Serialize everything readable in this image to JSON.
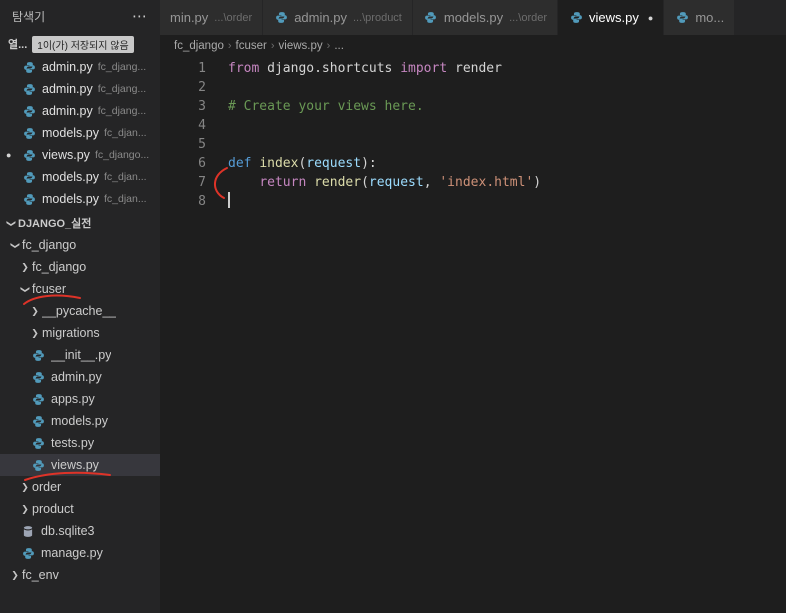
{
  "colors": {
    "editor_bg": "#1e1e1e",
    "sidebar_bg": "#252526",
    "tab_inactive_bg": "#2d2d2d",
    "selection_bg": "#37373d",
    "python_icon": "#519aba",
    "database_icon": "#9da5b4"
  },
  "icons": {
    "more": "⋯",
    "dirty_dot": "●",
    "chevron": "❯",
    "breadcrumb_sep": "›"
  },
  "annotations": {
    "color": "#de3328"
  },
  "sidebar": {
    "title": "탐색기",
    "open_editors": {
      "label": "열...",
      "badge": "1이(가) 저장되지 않음",
      "items": [
        {
          "name": "admin.py",
          "path": "fc_djang...",
          "dirty": false
        },
        {
          "name": "admin.py",
          "path": "fc_djang...",
          "dirty": false
        },
        {
          "name": "admin.py",
          "path": "fc_djang...",
          "dirty": false
        },
        {
          "name": "models.py",
          "path": "fc_djan...",
          "dirty": false
        },
        {
          "name": "views.py",
          "path": "fc_django...",
          "dirty": true
        },
        {
          "name": "models.py",
          "path": "fc_djan...",
          "dirty": false
        },
        {
          "name": "models.py",
          "path": "fc_djan...",
          "dirty": false
        }
      ]
    },
    "tree": {
      "root": "DJANGO_실전",
      "items": [
        {
          "label": "fc_django",
          "level": 0,
          "type": "folder",
          "chevron": "expanded"
        },
        {
          "label": "fc_django",
          "level": 1,
          "type": "folder",
          "chevron": "collapsed"
        },
        {
          "label": "fcuser",
          "level": 1,
          "type": "folder",
          "chevron": "expanded"
        },
        {
          "label": "__pycache__",
          "level": 2,
          "type": "folder",
          "chevron": "collapsed"
        },
        {
          "label": "migrations",
          "level": 2,
          "type": "folder",
          "chevron": "collapsed"
        },
        {
          "label": "__init__.py",
          "level": 2,
          "type": "file",
          "icon": "python"
        },
        {
          "label": "admin.py",
          "level": 2,
          "type": "file",
          "icon": "python"
        },
        {
          "label": "apps.py",
          "level": 2,
          "type": "file",
          "icon": "python"
        },
        {
          "label": "models.py",
          "level": 2,
          "type": "file",
          "icon": "python"
        },
        {
          "label": "tests.py",
          "level": 2,
          "type": "file",
          "icon": "python"
        },
        {
          "label": "views.py",
          "level": 2,
          "type": "file",
          "icon": "python",
          "selected": true
        },
        {
          "label": "order",
          "level": 1,
          "type": "folder",
          "chevron": "collapsed"
        },
        {
          "label": "product",
          "level": 1,
          "type": "folder",
          "chevron": "collapsed"
        },
        {
          "label": "db.sqlite3",
          "level": 1,
          "type": "file",
          "icon": "database"
        },
        {
          "label": "manage.py",
          "level": 1,
          "type": "file",
          "icon": "python"
        },
        {
          "label": "fc_env",
          "level": 0,
          "type": "folder",
          "chevron": "collapsed"
        }
      ]
    }
  },
  "tabs": [
    {
      "label": "min.py",
      "desc": "...\\order",
      "active": false,
      "icon": false,
      "dirty": false
    },
    {
      "label": "admin.py",
      "desc": "...\\product",
      "active": false,
      "icon": true,
      "dirty": false
    },
    {
      "label": "models.py",
      "desc": "...\\order",
      "active": false,
      "icon": true,
      "dirty": false
    },
    {
      "label": "views.py",
      "desc": "",
      "active": true,
      "icon": true,
      "dirty": true
    },
    {
      "label": "mo...",
      "desc": "",
      "active": false,
      "icon": true,
      "dirty": false
    }
  ],
  "breadcrumb": {
    "items": [
      "fc_django",
      "fcuser",
      "views.py",
      "..."
    ]
  },
  "editor": {
    "lines": [
      {
        "num": 1,
        "tokens": [
          {
            "t": "from",
            "c": "#C586C0"
          },
          {
            "t": " django.shortcuts ",
            "c": "#D4D4D4"
          },
          {
            "t": "import",
            "c": "#C586C0"
          },
          {
            "t": " render",
            "c": "#D4D4D4"
          }
        ]
      },
      {
        "num": 2,
        "tokens": []
      },
      {
        "num": 3,
        "tokens": [
          {
            "t": "# Create your views here.",
            "c": "#6A9955"
          }
        ]
      },
      {
        "num": 4,
        "tokens": []
      },
      {
        "num": 5,
        "tokens": []
      },
      {
        "num": 6,
        "tokens": [
          {
            "t": "def",
            "c": "#569CD6"
          },
          {
            "t": " ",
            "c": "#D4D4D4"
          },
          {
            "t": "index",
            "c": "#DCDCAA"
          },
          {
            "t": "(",
            "c": "#D4D4D4"
          },
          {
            "t": "request",
            "c": "#9CDCFE"
          },
          {
            "t": "):",
            "c": "#D4D4D4"
          }
        ]
      },
      {
        "num": 7,
        "tokens": [
          {
            "t": "    ",
            "c": "#D4D4D4"
          },
          {
            "t": "return",
            "c": "#C586C0"
          },
          {
            "t": " ",
            "c": "#D4D4D4"
          },
          {
            "t": "render",
            "c": "#DCDCAA"
          },
          {
            "t": "(",
            "c": "#D4D4D4"
          },
          {
            "t": "request",
            "c": "#9CDCFE"
          },
          {
            "t": ", ",
            "c": "#D4D4D4"
          },
          {
            "t": "'index.html'",
            "c": "#CE9178"
          },
          {
            "t": ")",
            "c": "#D4D4D4"
          }
        ]
      },
      {
        "num": 8,
        "tokens": [],
        "cursor": true
      }
    ]
  }
}
